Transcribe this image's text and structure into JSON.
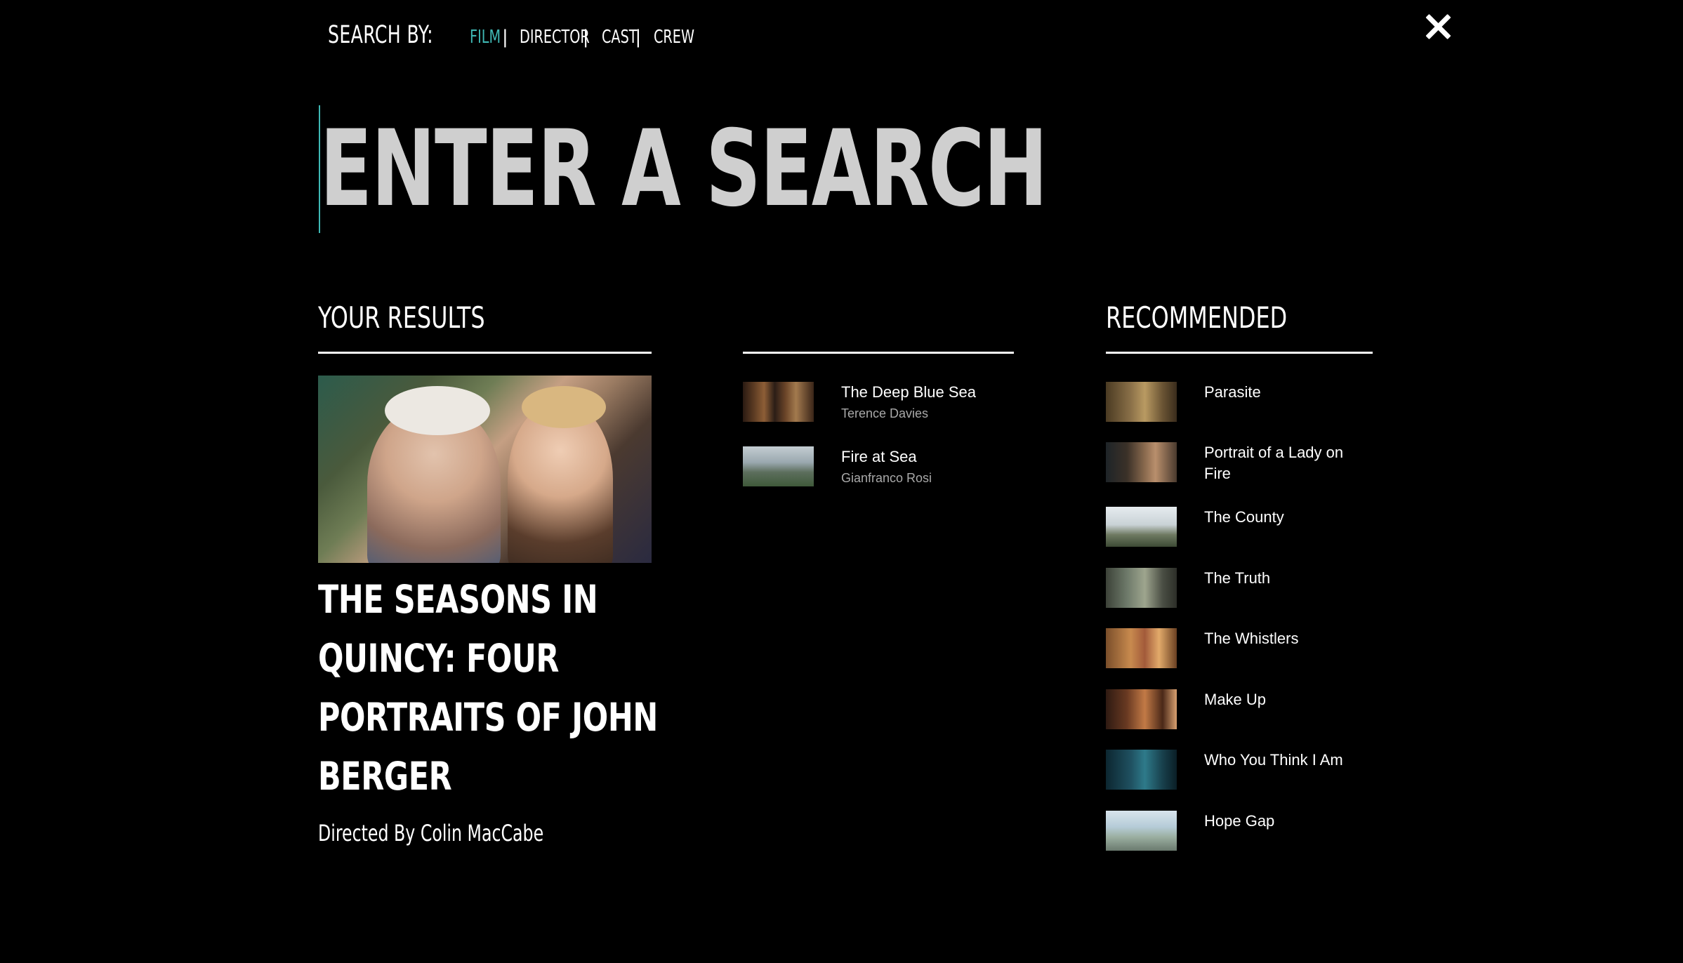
{
  "search_by": {
    "label": "SEARCH BY:",
    "options": [
      "FILM",
      "DIRECTOR",
      "CAST",
      "CREW"
    ],
    "active": "FILM",
    "separator": "|"
  },
  "search": {
    "placeholder": "ENTER A SEARCH",
    "value": ""
  },
  "results": {
    "heading": "YOUR RESULTS",
    "featured": {
      "title_lines": [
        "THE SEASONS IN",
        "QUINCY: FOUR",
        "PORTRAITS OF JOHN",
        "BERGER"
      ],
      "director": "Directed By Colin MacCabe"
    },
    "items": [
      {
        "title": "The Deep Blue Sea",
        "director": "Terence Davies"
      },
      {
        "title": "Fire at Sea",
        "director": "Gianfranco Rosi"
      }
    ]
  },
  "recommended": {
    "heading": "RECOMMENDED",
    "items": [
      {
        "title": "Parasite"
      },
      {
        "title": "Portrait of a Lady on Fire"
      },
      {
        "title": "The County"
      },
      {
        "title": "The Truth"
      },
      {
        "title": "The Whistlers"
      },
      {
        "title": "Make Up"
      },
      {
        "title": "Who You Think I Am"
      },
      {
        "title": "Hope Gap"
      }
    ]
  },
  "colors": {
    "accent": "#3fb8b4",
    "background": "#000000",
    "placeholder": "#cfcfcf",
    "subtext": "#a9a9a9"
  },
  "icons": {
    "close": "close-icon"
  }
}
